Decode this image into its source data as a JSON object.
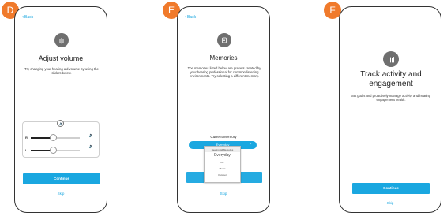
{
  "panels": [
    {
      "badge": "D",
      "back_label": "Back",
      "icon": "hand-wave-icon",
      "title": "Adjust volume",
      "description": "Try changing your hearing aid volume by using the sliders below.",
      "sliders": {
        "left_label": "R",
        "right_label": "L",
        "right_level": 0.45,
        "left_level": 0.45
      },
      "primary_button": "Continue",
      "skip_label": "Skip"
    },
    {
      "badge": "E",
      "back_label": "Back",
      "icon": "memories-icon",
      "title": "Memories",
      "description": "The memories listed below are presets created by your hearing professional for common listening environments. Try selecting a different memory.",
      "current_memory_label": "Current Memory",
      "dropdown_value": "Everyday",
      "dropdown_options": [
        "Hearing Aid Memories",
        "Everyday",
        "Fly",
        "Music",
        "Outdoor"
      ],
      "primary_button": "Continue",
      "skip_label": "Skip"
    },
    {
      "badge": "F",
      "icon": "bar-chart-icon",
      "title": "Track activity and engagement",
      "description": "Set goals and proactively manage activity and hearing engagement health.",
      "primary_button": "Continue",
      "skip_label": "Skip"
    }
  ],
  "colors": {
    "accent": "#1aa7e0",
    "badge": "#f07a2b",
    "icon_bg": "#6f6f6f"
  }
}
